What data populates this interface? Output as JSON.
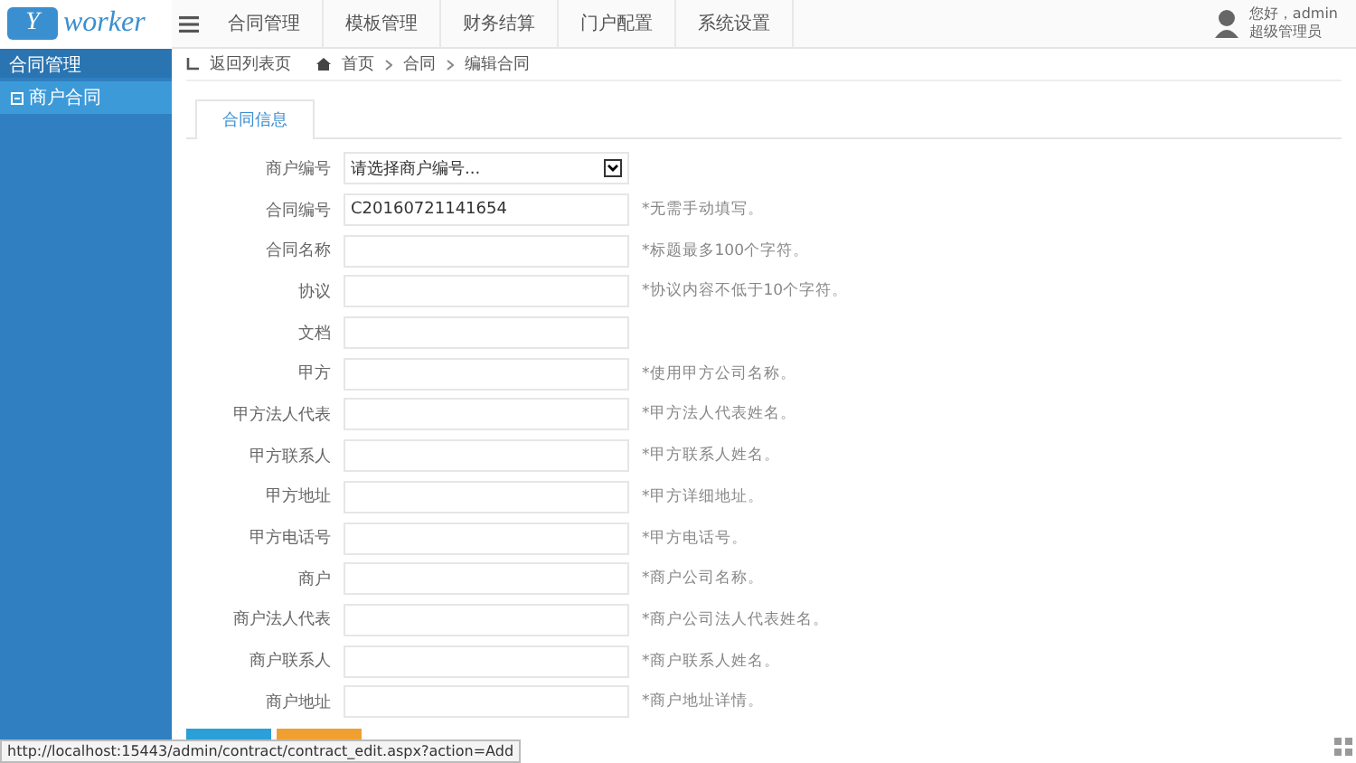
{
  "logo": {
    "letter": "Y",
    "word": "worker"
  },
  "nav": [
    {
      "label": "合同管理",
      "selected": false
    },
    {
      "label": "模板管理",
      "selected": false
    },
    {
      "label": "财务结算",
      "selected": false
    },
    {
      "label": "门户配置",
      "selected": false
    },
    {
      "label": "系统设置",
      "selected": false
    }
  ],
  "user": {
    "greeting": "您好，admin",
    "role": "超级管理员"
  },
  "sidebar": {
    "title": "合同管理",
    "items": [
      {
        "label": "商户合同",
        "selected": true
      }
    ]
  },
  "breadcrumb": {
    "back": "返回列表页",
    "items": [
      "首页",
      "合同",
      "编辑合同"
    ]
  },
  "tabs": [
    {
      "label": "合同信息",
      "selected": true
    }
  ],
  "form": [
    {
      "kind": "select",
      "label": "商户编号",
      "placeholder": "请选择商户编号..."
    },
    {
      "kind": "input",
      "label": "合同编号",
      "value": "C20160721141654",
      "hint": "*无需手动填写。"
    },
    {
      "kind": "input",
      "label": "合同名称",
      "hint": "*标题最多100个字符。"
    },
    {
      "kind": "input",
      "label": "协议",
      "hint": "*协议内容不低于10个字符。"
    },
    {
      "kind": "input",
      "label": "文档"
    },
    {
      "kind": "input",
      "label": "甲方",
      "hint": "*使用甲方公司名称。"
    },
    {
      "kind": "input",
      "label": "甲方法人代表",
      "hint": "*甲方法人代表姓名。"
    },
    {
      "kind": "input",
      "label": "甲方联系人",
      "hint": "*甲方联系人姓名。"
    },
    {
      "kind": "input",
      "label": "甲方地址",
      "hint": "*甲方详细地址。"
    },
    {
      "kind": "input",
      "label": "甲方电话号",
      "hint": "*甲方电话号。"
    },
    {
      "kind": "input",
      "label": "商户",
      "hint": "*商户公司名称。"
    },
    {
      "kind": "input",
      "label": "商户法人代表",
      "hint": "*商户公司法人代表姓名。"
    },
    {
      "kind": "input",
      "label": "商户联系人",
      "hint": "*商户联系人姓名。"
    },
    {
      "kind": "input",
      "label": "商户地址",
      "hint": "*商户地址详情。"
    }
  ],
  "status_url": "http://localhost:15443/admin/contract/contract_edit.aspx?action=Add"
}
